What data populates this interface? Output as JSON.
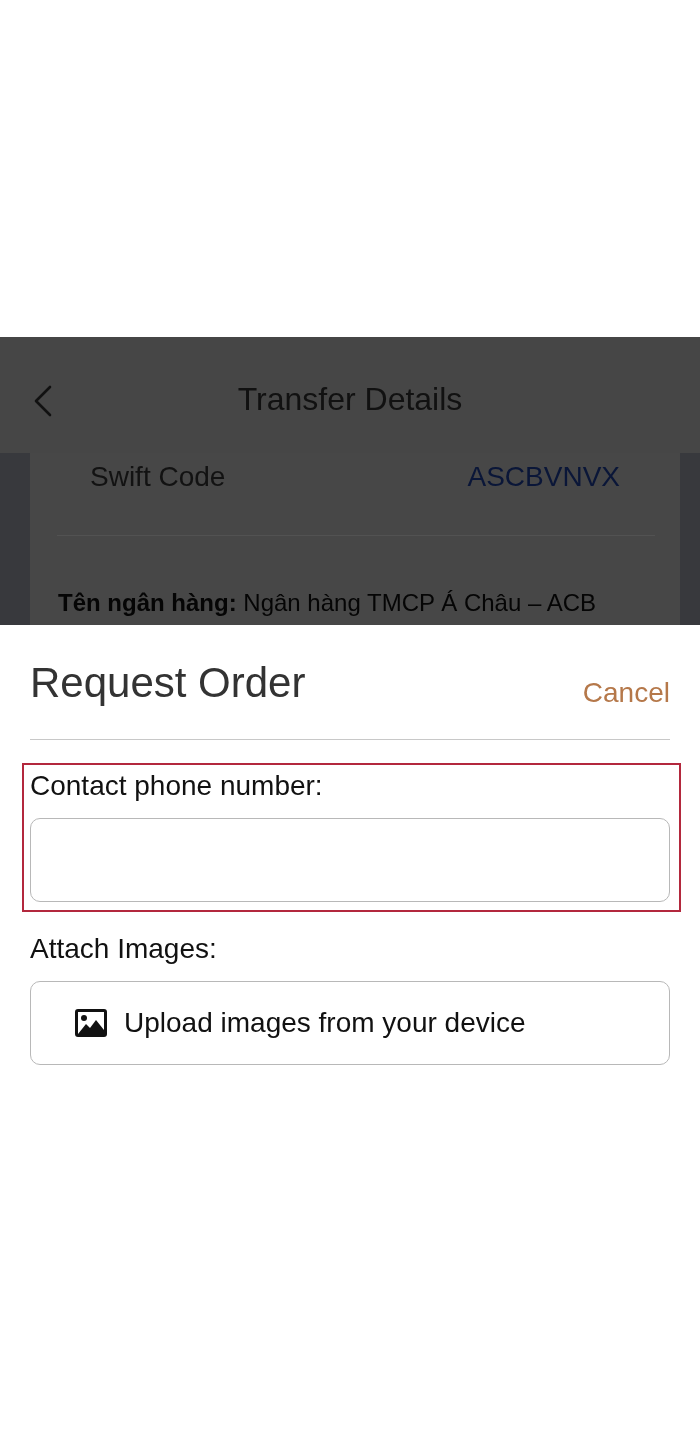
{
  "background_screen": {
    "header": {
      "title": "Transfer Details"
    },
    "card": {
      "label": "Swift Code",
      "value": "ASCBVNVX"
    },
    "bank_line": "**Tên ngân hàng:** Ngân hàng TMCP Á Châu – ACB"
  },
  "sheet": {
    "title": "Request Order",
    "cancel": "Cancel",
    "fields": [
      {
        "kind": "text",
        "label": "Contact phone number:",
        "highlighted": true
      },
      {
        "kind": "upload",
        "label": "Attach Images:",
        "button": "Upload images from your device",
        "highlighted": false
      }
    ]
  }
}
